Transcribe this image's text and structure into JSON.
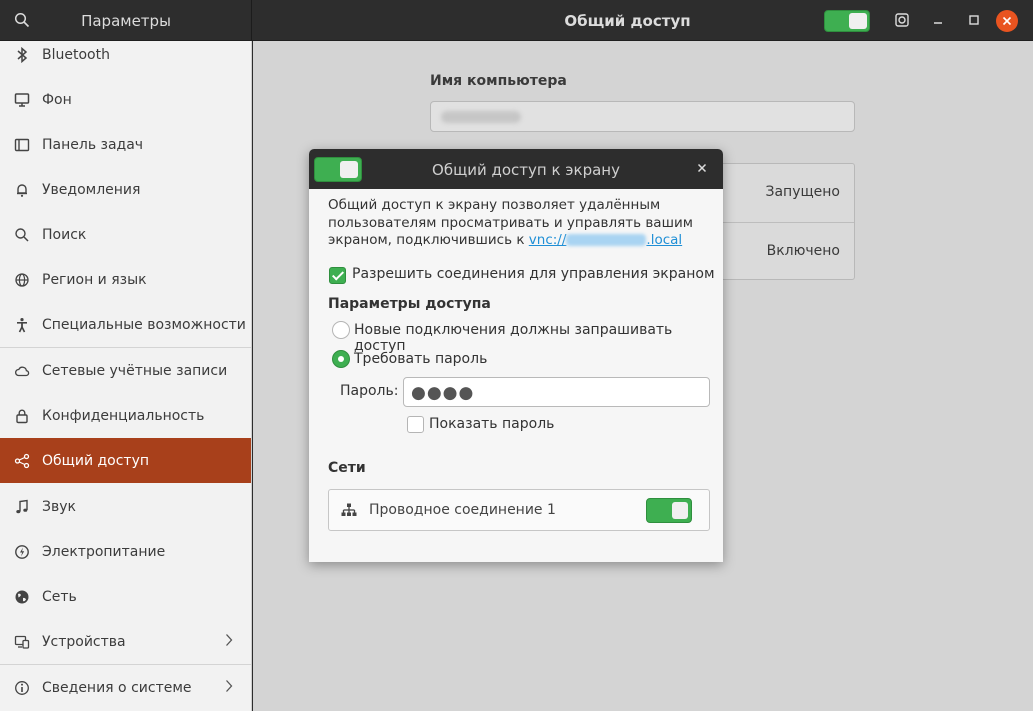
{
  "window": {
    "sidebar_title": "Параметры",
    "title": "Общий доступ"
  },
  "sidebar": {
    "items": [
      {
        "label": "Bluetooth",
        "icon": "bluetooth-icon"
      },
      {
        "label": "Фон",
        "icon": "monitor-icon"
      },
      {
        "label": "Панель задач",
        "icon": "dock-icon"
      },
      {
        "label": "Уведомления",
        "icon": "bell-icon"
      },
      {
        "label": "Поиск",
        "icon": "search-icon"
      },
      {
        "label": "Регион и язык",
        "icon": "globe-icon"
      },
      {
        "label": "Специальные возможности",
        "icon": "accessibility-icon"
      },
      {
        "label": "Сетевые учётные записи",
        "icon": "cloud-icon"
      },
      {
        "label": "Конфиденциальность",
        "icon": "lock-icon"
      },
      {
        "label": "Общий доступ",
        "icon": "share-icon",
        "active": true
      },
      {
        "label": "Звук",
        "icon": "music-note-icon"
      },
      {
        "label": "Электропитание",
        "icon": "power-icon"
      },
      {
        "label": "Сеть",
        "icon": "network-globe-icon"
      },
      {
        "label": "Устройства",
        "icon": "devices-icon",
        "has_chevron": true
      },
      {
        "label": "Сведения о системе",
        "icon": "info-icon",
        "has_chevron": true
      }
    ]
  },
  "main": {
    "computer_name_label": "Имя компьютера",
    "rows": [
      {
        "value": "Запущено"
      },
      {
        "value": "Включено"
      }
    ]
  },
  "dialog": {
    "title": "Общий доступ к экрану",
    "enabled": true,
    "description_line1": "Общий доступ к экрану позволяет удалённым",
    "description_line2": "пользователям просматривать и управлять вашим",
    "description_line3_prefix": "экраном, подключившись к ",
    "link_prefix": "vnc://",
    "link_suffix": ".local",
    "allow_control_label": "Разрешить соединения для управления экраном",
    "allow_control_checked": true,
    "access_params_title": "Параметры доступа",
    "option_new_connections": "Новые подключения должны запрашивать доступ",
    "option_require_password": "Требовать пароль",
    "selected_option": "require_password",
    "password_label": "Пароль:",
    "password_mask": "●●●●",
    "show_password_label": "Показать пароль",
    "show_password_checked": false,
    "networks_title": "Сети",
    "network_name": "Проводное соединение 1",
    "network_enabled": true
  },
  "colors": {
    "accent_active": "#a8401b",
    "switch_on": "#3eaf51",
    "close_button": "#e95420",
    "link": "#1f8fd6"
  }
}
